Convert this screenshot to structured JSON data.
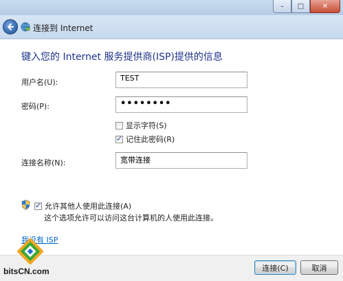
{
  "window": {
    "minimize_symbol": "–",
    "maximize_symbol": "□",
    "close_symbol": "✕"
  },
  "nav": {
    "title": "连接到 Internet"
  },
  "heading": "键入您的 Internet 服务提供商(ISP)提供的信息",
  "form": {
    "username_label": "用户名(U):",
    "username_value": "TEST",
    "password_label": "密码(P):",
    "password_value": "••••••••",
    "show_chars_label": "显示字符(S)",
    "show_chars_checked": false,
    "remember_label": "记住此密码(R)",
    "remember_checked": true,
    "conn_name_label": "连接名称(N):",
    "conn_name_value": "宽带连接"
  },
  "allow_others": {
    "label": "允许其他人使用此连接(A)",
    "checked": true,
    "description": "这个选项允许可以访问这台计算机的人使用此连接。"
  },
  "no_isp_link": "我没有 ISP",
  "buttons": {
    "connect": "连接(C)",
    "cancel": "取消"
  },
  "watermark": {
    "text": "bitsCN.com"
  },
  "colors": {
    "heading": "#1e3287",
    "link": "#0066cc",
    "titlebar": "#c9dbee",
    "footer": "#f0f0f0"
  },
  "icons": {
    "back": "back-arrow-icon",
    "network": "network-globe-icon",
    "shield": "uac-shield-icon",
    "check": "checkmark-icon"
  }
}
